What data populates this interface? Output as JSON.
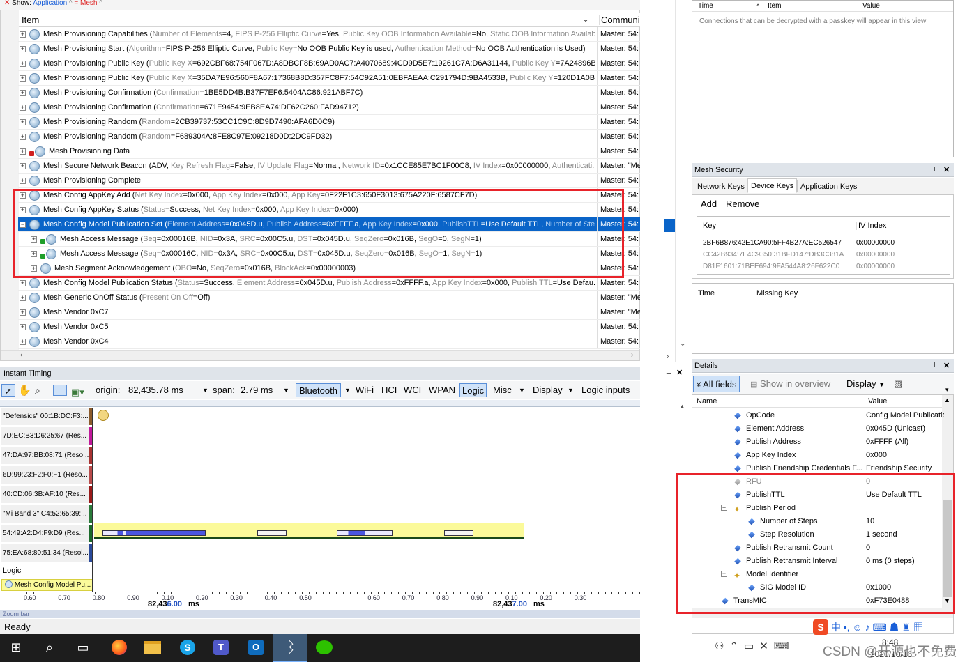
{
  "filterbar": {
    "close": "✕",
    "show": "Show:",
    "application": "Application",
    "caret1": "^",
    "sep": "=",
    "mesh": "Mesh",
    "caret2": "^"
  },
  "packets": {
    "col_item": "Item",
    "col_comm": "Communic",
    "rows": [
      {
        "name": "Mesh Provisioning Capabilities",
        "fields": [
          [
            "Number of Elements",
            "4"
          ],
          [
            "FIPS P-256 Elliptic Curve",
            "Yes"
          ],
          [
            "Public Key OOB Information Available",
            "No"
          ],
          [
            "Static OOB Information Available",
            "N"
          ]
        ],
        "open": "(",
        "comm": "Master: 54:"
      },
      {
        "name": "Mesh Provisioning Start",
        "fields": [
          [
            "Algorithm",
            "FIPS P-256 Elliptic Curve"
          ],
          [
            "Public Key",
            "No OOB Public Key is used"
          ],
          [
            "Authentication Method",
            "No OOB Authentication is Used"
          ]
        ],
        "open": "(",
        "close": ")",
        "comm": "Master: 54:"
      },
      {
        "name": "Mesh Provisioning Public Key",
        "fields": [
          [
            "Public Key X",
            "692CBF68:754F067D:A8DBCF8B:69AD0AC7:A4070689:4CD9D5E7:19261C7A:D6A31144"
          ],
          [
            "Public Key Y",
            "7A24896B:8..."
          ]
        ],
        "open": "(",
        "comm": "Master: 54:"
      },
      {
        "name": "Mesh Provisioning Public Key",
        "fields": [
          [
            "Public Key X",
            "35DA7E96:560F8A67:17368B8D:357FC8F7:54C92A51:0EBFAEAA:C291794D:9BA4533B"
          ],
          [
            "Public Key Y",
            "120D1A0B:DC..."
          ]
        ],
        "open": "(",
        "comm": "Master: 54:"
      },
      {
        "name": "Mesh Provisioning Confirmation",
        "fields": [
          [
            "Confirmation",
            "1BE5DD4B:B37F7EF6:5404AC86:921ABF7C"
          ]
        ],
        "open": "(",
        "close": ")",
        "comm": "Master: 54:"
      },
      {
        "name": "Mesh Provisioning Confirmation",
        "fields": [
          [
            "Confirmation",
            "671E9454:9EB8EA74:DF62C260:FAD94712"
          ]
        ],
        "open": "(",
        "close": ")",
        "comm": "Master: 54:"
      },
      {
        "name": "Mesh Provisioning Random",
        "fields": [
          [
            "Random",
            "2CB39737:53CC1C9C:8D9D7490:AFA6D0C9"
          ]
        ],
        "open": "(",
        "close": ")",
        "comm": "Master: 54:"
      },
      {
        "name": "Mesh Provisioning Random",
        "fields": [
          [
            "Random",
            "F689304A:8FE8C97E:09218D0D:2DC9FD32"
          ]
        ],
        "open": "(",
        "close": ")",
        "comm": "Master: 54:"
      },
      {
        "name": "Mesh Provisioning Data",
        "fields": [],
        "comm": "Master: 54:",
        "lock": "red"
      },
      {
        "name": "Mesh Secure Network Beacon",
        "fields": [
          [
            "Key Refresh Flag",
            "False"
          ],
          [
            "IV Update Flag",
            "Normal"
          ],
          [
            "Network ID",
            "0x1CCE85E7BC1F00C8"
          ],
          [
            "IV Index",
            "0x00000000"
          ],
          [
            "Authenticati...",
            ""
          ]
        ],
        "open": "(ADV, ",
        "comm": "Master: \"Me"
      },
      {
        "name": "Mesh Provisioning Complete",
        "fields": [],
        "comm": "Master: 54:"
      },
      {
        "name": "Mesh Config AppKey Add",
        "fields": [
          [
            "Net Key Index",
            "0x000"
          ],
          [
            "App Key Index",
            "0x000"
          ],
          [
            "App Key",
            "0F22F1C3:650F3013:675A220F:6587CF7D"
          ]
        ],
        "open": "(",
        "close": ")",
        "comm": "Master: 54:"
      },
      {
        "name": "Mesh Config AppKey Status",
        "fields": [
          [
            "Status",
            "Success"
          ],
          [
            "Net Key Index",
            "0x000"
          ],
          [
            "App Key Index",
            "0x000"
          ]
        ],
        "open": "(",
        "close": ")",
        "comm": "Master: 54:"
      },
      {
        "name": "Mesh Config Model Publication Set",
        "fields": [
          [
            "Element Address",
            "0x045D.u"
          ],
          [
            "Publish Address",
            "0xFFFF.a"
          ],
          [
            "App Key Index",
            "0x000"
          ],
          [
            "PublishTTL",
            "Use Default TTL"
          ],
          [
            "Number of Ste...",
            ""
          ]
        ],
        "open": "(",
        "comm": "Master: 54:",
        "sel": true
      },
      {
        "name": "Mesh Access Message",
        "fields": [
          [
            "Seq",
            "0x00016B"
          ],
          [
            "NID",
            "0x3A"
          ],
          [
            "SRC",
            "0x00C5.u"
          ],
          [
            "DST",
            "0x045D.u"
          ],
          [
            "SeqZero",
            "0x016B"
          ],
          [
            "SegO",
            "0"
          ],
          [
            "SegN",
            "1"
          ]
        ],
        "open": "(",
        "close": ")",
        "comm": "Master: 54:",
        "lock": "green",
        "child": true
      },
      {
        "name": "Mesh Access Message",
        "fields": [
          [
            "Seq",
            "0x00016C"
          ],
          [
            "NID",
            "0x3A"
          ],
          [
            "SRC",
            "0x00C5.u"
          ],
          [
            "DST",
            "0x045D.u"
          ],
          [
            "SeqZero",
            "0x016B"
          ],
          [
            "SegO",
            "1"
          ],
          [
            "SegN",
            "1"
          ]
        ],
        "open": "(",
        "close": ")",
        "comm": "Master: 54:",
        "lock": "green",
        "child": true
      },
      {
        "name": "Mesh Segment Acknowledgement",
        "fields": [
          [
            "OBO",
            "No"
          ],
          [
            "SeqZero",
            "0x016B"
          ],
          [
            "BlockAck",
            "0x00000003"
          ]
        ],
        "open": "(",
        "close": ")",
        "comm": "Master: 54:",
        "child": true
      },
      {
        "name": "Mesh Config Model Publication Status",
        "fields": [
          [
            "Status",
            "Success"
          ],
          [
            "Element Address",
            "0x045D.u"
          ],
          [
            "Publish Address",
            "0xFFFF.a"
          ],
          [
            "App Key Index",
            "0x000"
          ],
          [
            "Publish TTL",
            "Use Defau..."
          ]
        ],
        "open": "(",
        "comm": "Master: 54:"
      },
      {
        "name": "Mesh Generic OnOff Status",
        "fields": [
          [
            "Present On Off",
            "Off"
          ]
        ],
        "open": "(",
        "close": ")",
        "comm": "Master: \"Me"
      },
      {
        "name": "Mesh Vendor 0xC7",
        "fields": [],
        "comm": "Master: \"Me"
      },
      {
        "name": "Mesh Vendor 0xC5",
        "fields": [],
        "comm": "Master: 54:"
      },
      {
        "name": "Mesh Vendor 0xC4",
        "fields": [],
        "comm": "Master: 54:"
      }
    ]
  },
  "timing": {
    "title": "Instant Timing",
    "origin_label": "origin:",
    "origin_value": "82,435.78 ms",
    "span_label": "span:",
    "span_value": "2.79 ms",
    "tabs": [
      "Bluetooth",
      "WiFi",
      "HCI",
      "WCI",
      "WPAN",
      "Logic",
      "Misc",
      "Display",
      "Logic inputs"
    ],
    "lanes": [
      {
        "label": "\"Defensics\" 00:1B:DC:F3:...",
        "color": "#8b5a2b"
      },
      {
        "label": "7D:EC:B3:D6:25:67 (Res...",
        "color": "#c0189a"
      },
      {
        "label": "47:DA:97:BB:08:71 (Reso...",
        "color": "#a83232"
      },
      {
        "label": "6D:99:23:F2:F0:F1 (Reso...",
        "color": "#b84a4a"
      },
      {
        "label": "40:CD:06:3B:AF:10 (Res...",
        "color": "#9a1a1a"
      },
      {
        "label": "\"Mi Band 3\" C4:52:65:39:...",
        "color": "#2a7a3a"
      },
      {
        "label": "54:49:A2:D4:F9:D9 (Res...",
        "color": "#1a6a2a"
      },
      {
        "label": "75:EA:68:80:51:34 (Resol...",
        "color": "#2a4a9a"
      }
    ],
    "logic_label": "Logic",
    "logic_item": "Mesh Config Model Pu...",
    "ticks_left": [
      "0.60",
      "0.70",
      "0.80",
      "0.90",
      "0.10",
      "0.20",
      "0.30",
      "0.40",
      "0.50"
    ],
    "ticks_right": [
      "0.60",
      "0.70",
      "0.80",
      "0.90",
      "0.10",
      "0.20",
      "0.30"
    ],
    "major1_a": "82,43",
    "major1_b": "6.00",
    "major1_unit": "ms",
    "major2_a": "82,43",
    "major2_b": "7.00",
    "major2_unit": "ms",
    "zoom_bar": "Zoom bar"
  },
  "status": {
    "ready": "Ready"
  },
  "topright": {
    "col_time": "Time",
    "col_item": "Item",
    "col_value": "Value",
    "message": "Connections that can be decrypted with a passkey will appear in this view"
  },
  "security": {
    "title": "Mesh Security",
    "pin": "⊥",
    "close": "✕",
    "tabs": [
      "Network Keys",
      "Device Keys",
      "Application Keys"
    ],
    "add": "Add",
    "remove": "Remove",
    "col_key": "Key",
    "col_iv": "IV Index",
    "keys": [
      {
        "key": "2BF6B876:42E1CA90:5FF4B27A:EC526547",
        "iv": "0x00000000",
        "dim": false
      },
      {
        "key": "CC42B934:7E4C9350:31BFD147:DB3C381A",
        "iv": "0x00000000",
        "dim": true
      },
      {
        "key": "D81F1601:71BEE694:9FA544A8:26F622C0",
        "iv": "0x00000000",
        "dim": true
      }
    ],
    "col_time": "Time",
    "col_missing": "Missing Key"
  },
  "details": {
    "title": "Details",
    "pin": "⊥",
    "close": "✕",
    "all_fields": "All fields",
    "show_overview": "Show in overview",
    "display": "Display",
    "col_name": "Name",
    "col_value": "Value",
    "rows": [
      {
        "name": "OpCode",
        "value": "Config Model Publicatio",
        "indent": 0,
        "kind": "dot"
      },
      {
        "name": "Element Address",
        "value": "0x045D (Unicast)",
        "indent": 0,
        "kind": "dot"
      },
      {
        "name": "Publish Address",
        "value": "0xFFFF (All)",
        "indent": 0,
        "kind": "dot"
      },
      {
        "name": "App Key Index",
        "value": "0x000",
        "indent": 0,
        "kind": "dot"
      },
      {
        "name": "Publish Friendship Credentials F...",
        "value": "Friendship Security",
        "indent": 0,
        "kind": "dot"
      },
      {
        "name": "RFU",
        "value": "0",
        "indent": 0,
        "kind": "dim"
      },
      {
        "name": "PublishTTL",
        "value": "Use Default TTL",
        "indent": 0,
        "kind": "dot"
      },
      {
        "name": "Publish Period",
        "value": "",
        "indent": 0,
        "kind": "group"
      },
      {
        "name": "Number of Steps",
        "value": "10",
        "indent": 1,
        "kind": "dot"
      },
      {
        "name": "Step Resolution",
        "value": "1 second",
        "indent": 1,
        "kind": "dot"
      },
      {
        "name": "Publish Retransmit Count",
        "value": "0",
        "indent": 0,
        "kind": "dot"
      },
      {
        "name": "Publish Retransmit Interval",
        "value": "0 ms (0 steps)",
        "indent": 0,
        "kind": "dot"
      },
      {
        "name": "Model Identifier",
        "value": "",
        "indent": 0,
        "kind": "group"
      },
      {
        "name": "SIG Model ID",
        "value": "0x1000",
        "indent": 1,
        "kind": "dot"
      },
      {
        "name": "TransMIC",
        "value": "0xF73E0488",
        "indent": -1,
        "kind": "dot"
      }
    ]
  },
  "taskbar": {
    "time": "8:48",
    "date": "2020/10/16",
    "ime": "中",
    "watermark": "CSDN @开源也不免费"
  }
}
